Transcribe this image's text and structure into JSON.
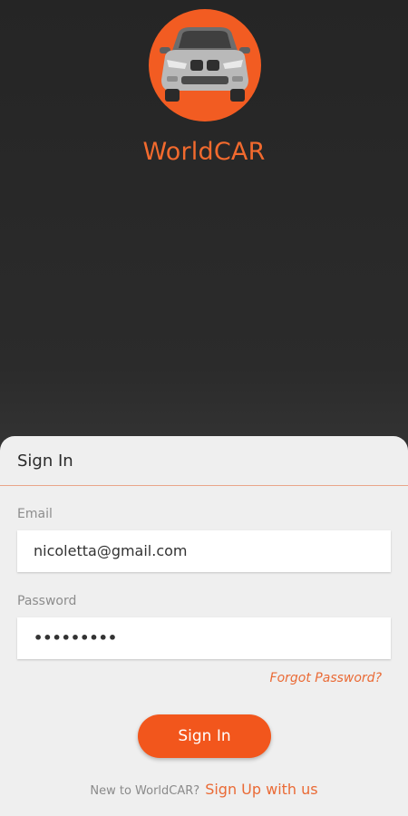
{
  "app": {
    "name": "WorldCAR",
    "brand_color": "#f25c22",
    "logo_icon": "car-front-icon"
  },
  "signin": {
    "title": "Sign In",
    "email_label": "Email",
    "email_value": "nicoletta@gmail.com",
    "password_label": "Password",
    "password_value": "•••••••••",
    "forgot_label": "Forgot Password?",
    "button_label": "Sign In"
  },
  "footer": {
    "prompt": "New to WorldCAR?",
    "signup_label": "Sign Up with us"
  }
}
